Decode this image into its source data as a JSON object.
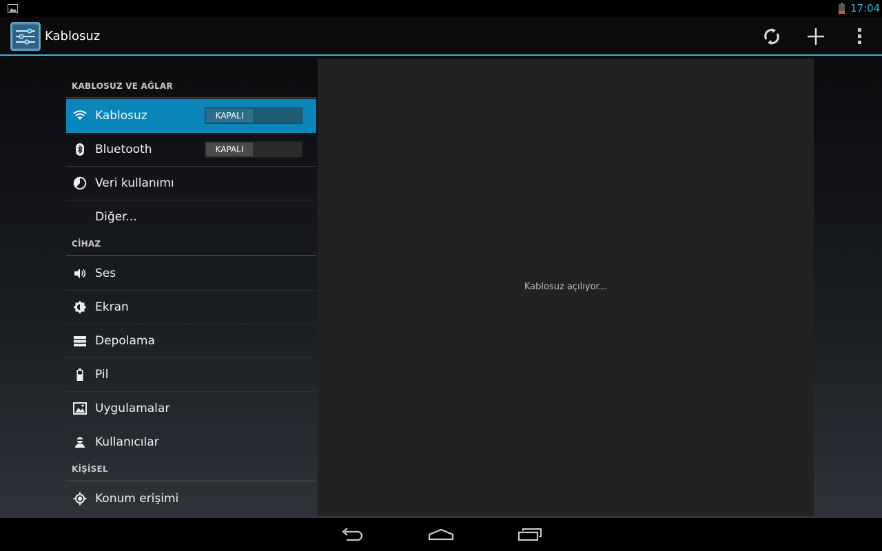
{
  "status_bar": {
    "time": "17:04",
    "icons": [
      "gallery-notification-icon",
      "battery-low-icon"
    ]
  },
  "action_bar": {
    "title": "Kablosuz",
    "actions": [
      "sync-wifi-icon",
      "add-icon",
      "overflow-menu-icon"
    ]
  },
  "settings": {
    "categories": {
      "wireless": "KABLOSUZ VE AĞLAR",
      "device": "CİHAZ",
      "personal": "KİŞİSEL"
    },
    "items": [
      {
        "label": "Kablosuz",
        "icon": "wifi-icon",
        "toggle": "KAPALI",
        "selected": true
      },
      {
        "label": "Bluetooth",
        "icon": "bluetooth-icon",
        "toggle": "KAPALI"
      },
      {
        "label": "Veri kullanımı",
        "icon": "data-usage-icon"
      },
      {
        "label": "Diğer..."
      },
      {
        "label": "Ses",
        "icon": "volume-icon"
      },
      {
        "label": "Ekran",
        "icon": "brightness-icon"
      },
      {
        "label": "Depolama",
        "icon": "storage-icon"
      },
      {
        "label": "Pil",
        "icon": "battery-icon"
      },
      {
        "label": "Uygulamalar",
        "icon": "apps-icon"
      },
      {
        "label": "Kullanıcılar",
        "icon": "user-icon"
      },
      {
        "label": "Konum erişimi",
        "icon": "location-icon"
      }
    ]
  },
  "detail": {
    "message": "Kablosuz açılıyor..."
  },
  "navigation": [
    "back-icon",
    "home-icon",
    "recent-apps-icon"
  ],
  "colors": {
    "accent": "#33b5e5",
    "selected": "#0b86bb",
    "battery_low": "#e05a16"
  }
}
